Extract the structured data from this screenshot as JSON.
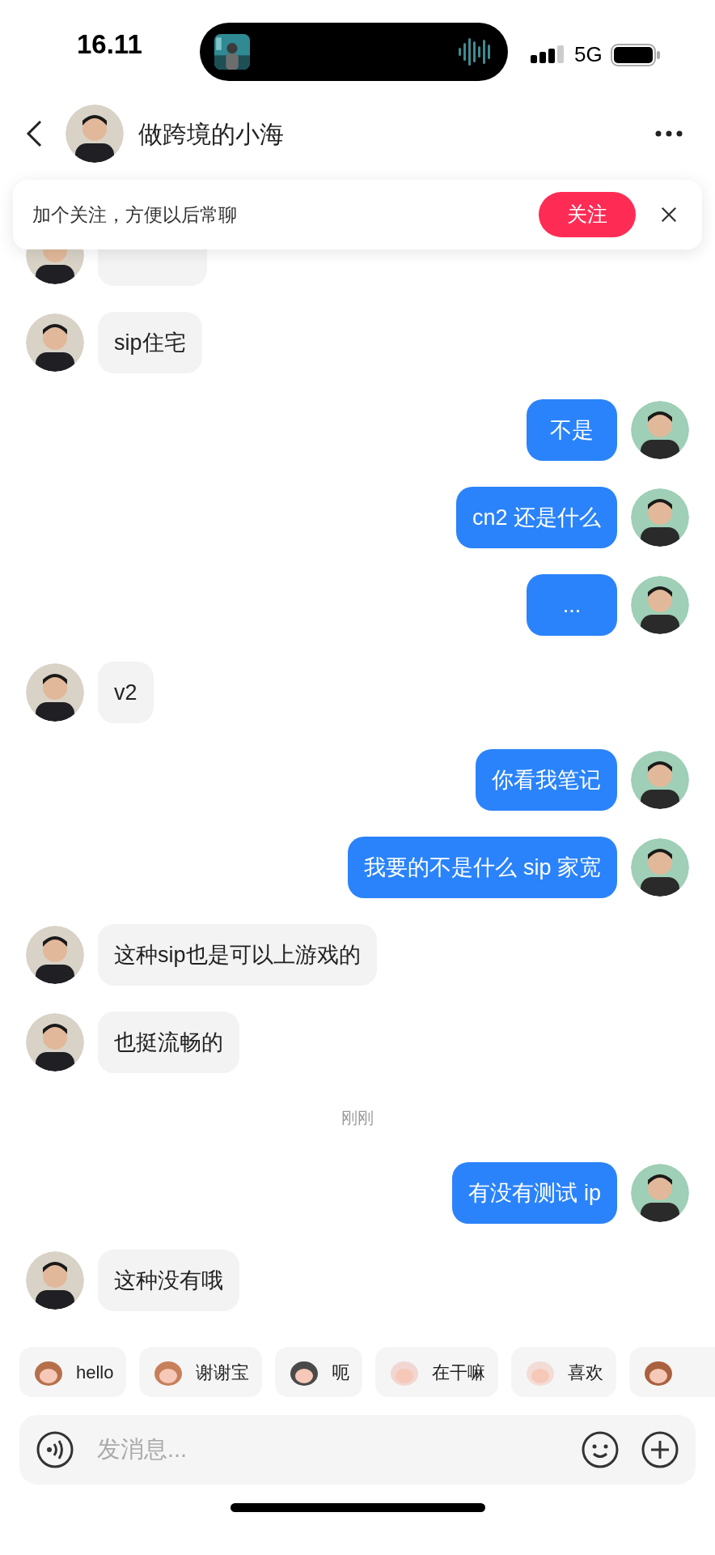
{
  "status_bar": {
    "time": "16.11",
    "network": "5G"
  },
  "header": {
    "title": "做跨境的小海"
  },
  "follow_banner": {
    "text": "加个关注，方便以后常聊",
    "button": "关注"
  },
  "messages": [
    {
      "kind": "incoming_covered"
    },
    {
      "kind": "incoming",
      "text": "sip住宅"
    },
    {
      "kind": "outgoing",
      "text": "不是"
    },
    {
      "kind": "outgoing",
      "text": "cn2 还是什么"
    },
    {
      "kind": "outgoing",
      "text": "..."
    },
    {
      "kind": "incoming",
      "text": "v2"
    },
    {
      "kind": "outgoing",
      "text": "你看我笔记"
    },
    {
      "kind": "outgoing",
      "text": "我要的不是什么 sip 家宽"
    },
    {
      "kind": "incoming",
      "text": "这种sip也是可以上游戏的"
    },
    {
      "kind": "incoming",
      "text": "也挺流畅的"
    },
    {
      "kind": "timestamp",
      "text": "刚刚"
    },
    {
      "kind": "outgoing",
      "text": "有没有测试 ip"
    },
    {
      "kind": "incoming",
      "text": "这种没有哦"
    }
  ],
  "quick_replies": [
    {
      "kind": "sticker",
      "label": "hello"
    },
    {
      "kind": "sticker",
      "label": "谢谢宝"
    },
    {
      "kind": "sticker",
      "label": "呃"
    },
    {
      "kind": "sticker",
      "label": "在干嘛"
    },
    {
      "kind": "sticker",
      "label": "喜欢"
    },
    {
      "kind": "cut"
    }
  ],
  "composer": {
    "placeholder": "发消息..."
  }
}
